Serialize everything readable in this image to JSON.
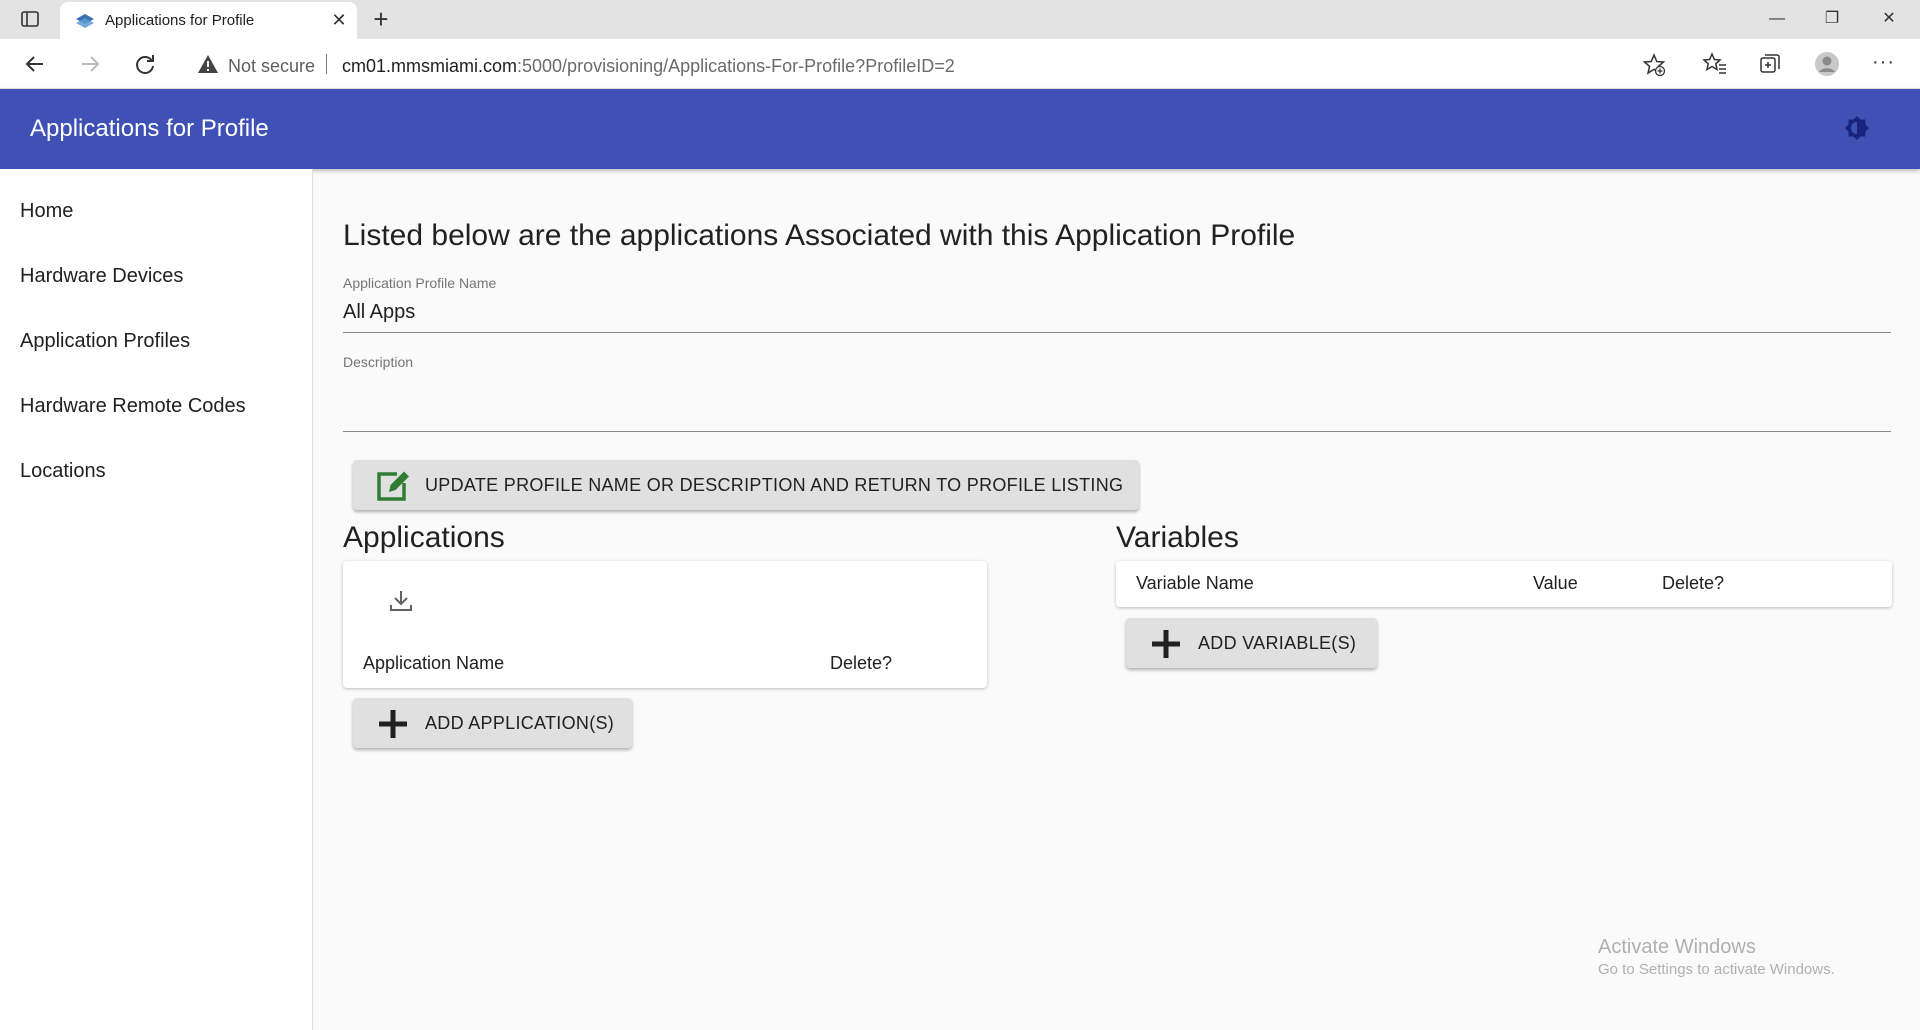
{
  "browser": {
    "tab_title": "Applications for Profile",
    "new_tab_symbol": "+",
    "close_symbol": "✕",
    "address": {
      "security_label": "Not secure",
      "url_host": "cm01.mmsmiami.com",
      "url_rest": ":5000/provisioning/Applications-For-Profile?ProfileID=2"
    },
    "window_controls": {
      "minimize": "—",
      "restore": "❐",
      "close": "✕"
    },
    "more_symbol": "···"
  },
  "app": {
    "title": "Applications for Profile",
    "theme_icon": "brightness-icon"
  },
  "sidebar": {
    "items": [
      {
        "label": "Home"
      },
      {
        "label": "Hardware Devices"
      },
      {
        "label": "Application Profiles"
      },
      {
        "label": "Hardware Remote Codes"
      },
      {
        "label": "Locations"
      }
    ]
  },
  "main": {
    "heading": "Listed below are the applications Associated with this Application Profile",
    "profile_name_label": "Application Profile Name",
    "profile_name_value": "All Apps",
    "description_label": "Description",
    "description_value": "",
    "update_button_label": "UPDATE PROFILE NAME OR DESCRIPTION AND RETURN TO PROFILE LISTING",
    "applications": {
      "title": "Applications",
      "columns": [
        "Application Name",
        "Delete?"
      ],
      "add_button_label": "ADD APPLICATION(S)"
    },
    "variables": {
      "title": "Variables",
      "columns": [
        "Variable Name",
        "Value",
        "Delete?"
      ],
      "add_button_label": "ADD VARIABLE(S)"
    }
  },
  "watermark": {
    "line1": "Activate Windows",
    "line2": "Go to Settings to activate Windows."
  },
  "colors": {
    "appbar": "#3f51b5",
    "edit_icon": "#2e7d32",
    "button_bg": "#e0e0e0"
  }
}
